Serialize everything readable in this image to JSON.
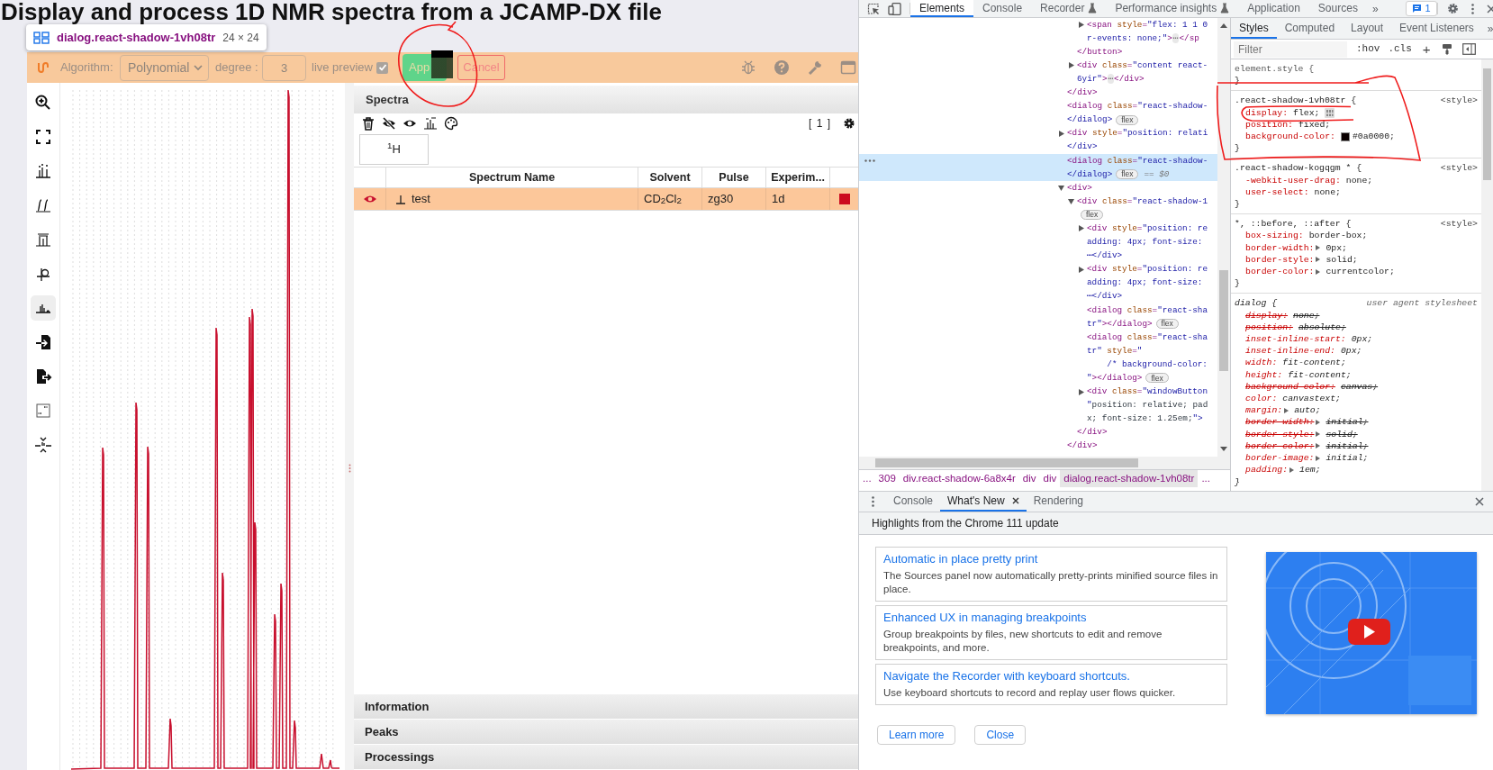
{
  "page": {
    "title": "Display and process 1D NMR spectra from a JCAMP-DX file"
  },
  "inspect_tooltip": {
    "selector": "dialog.react-shadow-1vh08tr",
    "size": "24 × 24"
  },
  "filter_toolbar": {
    "algorithm_label": "Algorithm:",
    "algorithm": "Polynomial",
    "degree_label": "degree :",
    "degree": "3",
    "live_preview_label": "live preview",
    "live_preview": true,
    "apply_label": "App",
    "cancel_label": "Cancel"
  },
  "tool_column": [
    {
      "kind": "zoom",
      "selected": false
    },
    {
      "kind": "fullscreen",
      "selected": false
    },
    {
      "kind": "peaks",
      "selected": false
    },
    {
      "kind": "integral",
      "selected": false
    },
    {
      "kind": "baseline",
      "selected": false
    },
    {
      "kind": "phase",
      "selected": false
    },
    {
      "kind": "spectrum",
      "selected": true
    },
    {
      "kind": "import",
      "selected": false
    },
    {
      "kind": "export",
      "selected": false
    },
    {
      "kind": "complex",
      "selected": false
    },
    {
      "kind": "compress",
      "selected": false
    }
  ],
  "spectra_panel": {
    "title": "Spectra",
    "count": "[ 1 ]",
    "tabs": [
      {
        "label": "$^{1}$H",
        "selected": true
      }
    ],
    "columns": [
      "Spectrum Name",
      "Solvent",
      "Pulse",
      "Experim..."
    ],
    "rows": [
      {
        "visible": true,
        "name": "test",
        "solvent": "CD$_{2}$Cl$_{2}$",
        "pulse": "zg30",
        "experiment": "1d",
        "color": "#cc0a1e",
        "selected": true
      }
    ]
  },
  "accordion": [
    {
      "title": "Information"
    },
    {
      "title": "Peaks"
    },
    {
      "title": "Processings"
    }
  ],
  "devtools": {
    "tabs": [
      {
        "label": "Elements",
        "selected": true,
        "experimental": false
      },
      {
        "label": "Console",
        "selected": false,
        "experimental": false
      },
      {
        "label": "Recorder",
        "selected": false,
        "experimental": true
      },
      {
        "label": "Performance insights",
        "selected": false,
        "experimental": true
      },
      {
        "label": "Application",
        "selected": false,
        "experimental": false
      },
      {
        "label": "Sources",
        "selected": false,
        "experimental": false
      }
    ],
    "more_tabs": "»",
    "issues_count": "1",
    "dom_tree": [
      {
        "selected": false,
        "close": "</div>",
        "children": [
          {
            "selected": false,
            "close": "</button>",
            "children": [
              {
                "lines": [
                  "<span style=\"flex: 1 1 0",
                  "r-events: none;\">⋯</sp"
                ],
                "expanded": false,
                "selected": false
              }
            ]
          },
          {
            "lines": [
              "<div class=\"content react-",
              "6yir\">⋯</div>"
            ],
            "expanded": false,
            "selected": false
          }
        ]
      },
      {
        "lines": [
          "<dialog class=\"react-shadow-",
          "</dialog>"
        ],
        "badge": "flex",
        "selected": false
      },
      {
        "lines": [
          "<div style=\"position: relati",
          "</div>"
        ],
        "expanded": false,
        "selected": false
      },
      {
        "lines": [
          "<dialog class=\"react-shadow-",
          "</dialog>"
        ],
        "badge": "flex",
        "suffix": "== $0",
        "selected": true
      },
      {
        "lines": [
          "<div>"
        ],
        "expanded": true,
        "selected": false,
        "close": "</div>",
        "children": [
          {
            "lines": [
              "<div class=\"react-shadow-1"
            ],
            "expanded": true,
            "badge": "flex",
            "badge_wraps": true,
            "selected": false,
            "close": "</div>",
            "children": [
              {
                "lines": [
                  "<div style=\"position: re",
                  "adding: 4px; font-size:",
                  "⋯</div>"
                ],
                "expanded": false,
                "selected": false
              },
              {
                "lines": [
                  "<div style=\"position: re",
                  "adding: 4px; font-size:",
                  "⋯</div>"
                ],
                "expanded": false,
                "selected": false
              },
              {
                "lines": [
                  "<dialog class=\"react-sha",
                  "tr\"></dialog>"
                ],
                "badge": "flex",
                "selected": false
              },
              {
                "lines": [
                  "<dialog class=\"react-sha",
                  "tr\" style=\"",
                  "    /* background-color:",
                  "\"></dialog>"
                ],
                "badge": "flex",
                "selected": false
              },
              {
                "lines": [
                  "<div class=\"windowButton",
                  "\"position: relative; pad",
                  "x; font-size: 1.25em;\">"
                ],
                "expanded": false,
                "selected": false
              }
            ]
          }
        ]
      }
    ],
    "breadcrumbs": [
      {
        "label": "...",
        "selected": false
      },
      {
        "label": "309",
        "selected": false
      },
      {
        "label": "div.react-shadow-6a8x4r",
        "selected": false
      },
      {
        "label": "div",
        "selected": false
      },
      {
        "label": "div",
        "selected": false
      },
      {
        "label": "dialog.react-shadow-1vh08tr",
        "selected": true
      },
      {
        "label": "...",
        "selected": false
      }
    ],
    "styles_tabs": [
      {
        "label": "Styles",
        "selected": true
      },
      {
        "label": "Computed",
        "selected": false
      },
      {
        "label": "Layout",
        "selected": false
      },
      {
        "label": "Event Listeners",
        "selected": false
      }
    ],
    "styles_more": "»",
    "filter": {
      "placeholder": "Filter",
      "hov": ":hov",
      "cls": ".cls",
      "add": "+"
    },
    "rules": [
      {
        "selector": "element.style {",
        "close": "}",
        "user_agent": false
      },
      {
        "selector": ".react-shadow-1vh08tr {",
        "source": "<style>",
        "close": "}",
        "user_agent": false,
        "properties": [
          {
            "name": "display:",
            "value": "flex;",
            "struck": false,
            "shorthand": false,
            "flex_editor": true
          },
          {
            "name": "position:",
            "value": "fixed;",
            "struck": false,
            "shorthand": false
          },
          {
            "name": "background-color:",
            "value": "#0a0000;",
            "struck": false,
            "shorthand": false,
            "color": "#0a0000"
          }
        ]
      },
      {
        "selector": ".react-shadow-kogqgm * {",
        "source": "<style>",
        "close": "}",
        "user_agent": false,
        "properties": [
          {
            "name": "-webkit-user-drag:",
            "value": "none;",
            "struck": false,
            "shorthand": false
          },
          {
            "name": "user-select:",
            "value": "none;",
            "struck": false,
            "shorthand": false
          }
        ]
      },
      {
        "selector": "*, ::before, ::after {",
        "source": "<style>",
        "close": "}",
        "user_agent": false,
        "properties": [
          {
            "name": "box-sizing:",
            "value": "border-box;",
            "struck": false,
            "shorthand": false
          },
          {
            "name": "border-width:",
            "value": "0px;",
            "struck": false,
            "shorthand": true
          },
          {
            "name": "border-style:",
            "value": "solid;",
            "struck": false,
            "shorthand": true
          },
          {
            "name": "border-color:",
            "value": "currentcolor;",
            "struck": false,
            "shorthand": true
          }
        ]
      },
      {
        "selector": "dialog {",
        "source": "user agent stylesheet",
        "close": "}",
        "user_agent": true,
        "properties": [
          {
            "name": "display:",
            "value": "none;",
            "struck": true,
            "shorthand": false
          },
          {
            "name": "position:",
            "value": "absolute;",
            "struck": true,
            "shorthand": false
          },
          {
            "name": "inset-inline-start:",
            "value": "0px;",
            "struck": false,
            "shorthand": false
          },
          {
            "name": "inset-inline-end:",
            "value": "0px;",
            "struck": false,
            "shorthand": false
          },
          {
            "name": "width:",
            "value": "fit-content;",
            "struck": false,
            "shorthand": false
          },
          {
            "name": "height:",
            "value": "fit-content;",
            "struck": false,
            "shorthand": false
          },
          {
            "name": "background-color:",
            "value": "canvas;",
            "struck": true,
            "shorthand": false
          },
          {
            "name": "color:",
            "value": "canvastext;",
            "struck": false,
            "shorthand": false
          },
          {
            "name": "margin:",
            "value": "auto;",
            "struck": false,
            "shorthand": true
          },
          {
            "name": "border-width:",
            "value": "initial;",
            "struck": true,
            "shorthand": true
          },
          {
            "name": "border-style:",
            "value": "solid;",
            "struck": true,
            "shorthand": true
          },
          {
            "name": "border-color:",
            "value": "initial;",
            "struck": true,
            "shorthand": true
          },
          {
            "name": "border-image:",
            "value": "initial;",
            "struck": false,
            "shorthand": true
          },
          {
            "name": "padding:",
            "value": "1em;",
            "struck": false,
            "shorthand": true
          }
        ]
      }
    ]
  },
  "drawer": {
    "tabs": [
      {
        "label": "Console",
        "selected": false,
        "closable": false
      },
      {
        "label": "What's New",
        "selected": true,
        "closable": true
      },
      {
        "label": "Rendering",
        "selected": false,
        "closable": false
      }
    ],
    "header": "Highlights from the Chrome 111 update",
    "articles": [
      {
        "title": "Automatic in place pretty print",
        "description": "The Sources panel now automatically pretty-prints minified source files in place."
      },
      {
        "title": "Enhanced UX in managing breakpoints",
        "description": "Group breakpoints by files, new shortcuts to edit and remove breakpoints, and more."
      },
      {
        "title": "Navigate the Recorder with keyboard shortcuts.",
        "description": "Use keyboard shortcuts to record and replay user flows quicker."
      }
    ],
    "buttons": [
      "Learn more",
      "Close"
    ],
    "video": {
      "kind": "picture"
    }
  }
}
